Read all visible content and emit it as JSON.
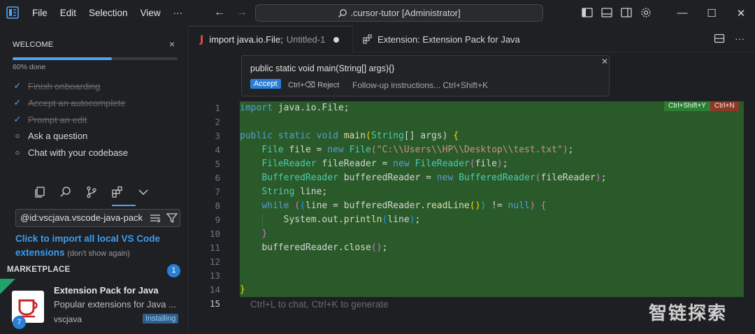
{
  "menu": {
    "items": [
      "File",
      "Edit",
      "Selection",
      "View",
      "···"
    ]
  },
  "command_center": {
    "text": ".cursor-tutor [Administrator]"
  },
  "window": {
    "minimize": "—",
    "maximize": "☐",
    "close": "✕"
  },
  "welcome": {
    "heading": "WELCOME",
    "progress_text": "60% done",
    "progress_fraction": 0.6,
    "tasks": [
      {
        "label": "Finish onboarding",
        "done": true
      },
      {
        "label": "Accept an autocomplete",
        "done": true
      },
      {
        "label": "Prompt an edit",
        "done": true
      },
      {
        "label": "Ask a question",
        "done": false
      },
      {
        "label": "Chat with your codebase",
        "done": false
      }
    ]
  },
  "extensions": {
    "search_value": "@id:vscjava.vscode-java-pack",
    "import_link": "Click to import all local VS Code extensions",
    "dont_show": "(don't show again)",
    "marketplace_heading": "MARKETPLACE",
    "marketplace_count": "1",
    "item": {
      "name": "Extension Pack for Java",
      "description": "Popular extensions for Java ...",
      "publisher": "vscjava",
      "status": "Installing",
      "count": "7"
    }
  },
  "tabs": [
    {
      "title": "import java.io.File;",
      "subtitle": "Untitled-1",
      "icon": "J"
    },
    {
      "title": "Extension: Extension Pack for Java"
    }
  ],
  "inline_edit": {
    "prompt": "public static void main(String[] args){}",
    "accept": "Accept",
    "reject": "Ctrl+⌫ Reject",
    "followup": "Follow-up instructions... Ctrl+Shift+K"
  },
  "diff_badges": {
    "accept": "Ctrl+Shift+Y",
    "reject": "Ctrl+N"
  },
  "line_numbers": [
    "1",
    "2",
    "3",
    "4",
    "5",
    "6",
    "7",
    "8",
    "9",
    "10",
    "11",
    "12",
    "13",
    "14",
    "15"
  ],
  "code": {
    "l1": {
      "kw": "import",
      "rest": " java.io.File;"
    },
    "l3": {
      "kw1": "public",
      "kw2": "static",
      "kw3": "void",
      "fn": "main",
      "ty": "String",
      "args": "[] args) "
    },
    "l4": {
      "ty": "File",
      "v": " file = ",
      "kw": "new",
      "ty2": "File",
      "str": "\"C:\\\\Users\\\\HP\\\\Desktop\\\\test.txt\""
    },
    "l5": {
      "ty": "FileReader",
      "v": " fileReader = ",
      "kw": "new",
      "ty2": "FileReader",
      "arg": "file"
    },
    "l6": {
      "ty": "BufferedReader",
      "v": " bufferedReader = ",
      "kw": "new",
      "ty2": "BufferedReader",
      "arg": "fileReader"
    },
    "l7": {
      "ty": "String",
      "v": " line;"
    },
    "l8": {
      "kw": "while",
      "a": "line = bufferedReader.",
      "fn": "readLine",
      "b": " != ",
      "kw2": "null"
    },
    "l9": {
      "a": "System.out.",
      "fn": "println",
      "arg": "line"
    },
    "l11": {
      "a": "bufferedReader.",
      "fn": "close"
    }
  },
  "hint": "Ctrl+L to chat, Ctrl+K to generate",
  "watermark": "智链探索",
  "colors": {
    "accent": "#4fa3f7",
    "diff_added": "#2a5a2a",
    "badge_accept": "#2e7d32",
    "badge_reject": "#8b3a2a"
  }
}
